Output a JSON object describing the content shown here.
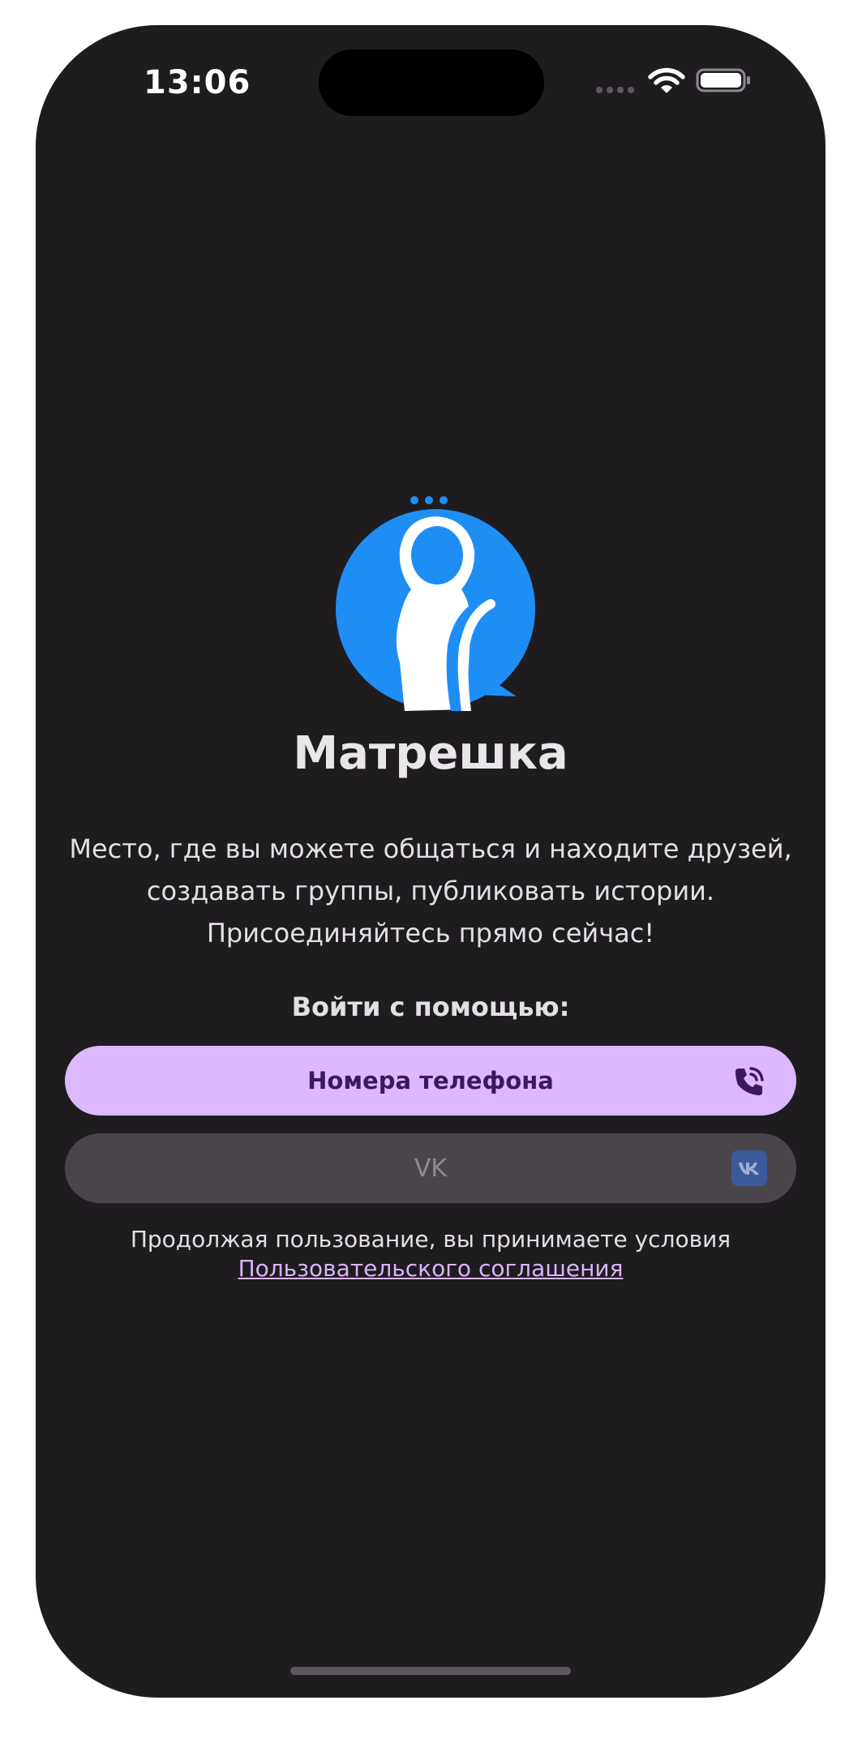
{
  "status_bar": {
    "time": "13:06"
  },
  "app": {
    "name": "Матрешка",
    "description_lines": [
      "Место, где вы можете общаться и находите друзей,",
      "создавать группы, публиковать истории.",
      "Присоединяйтесь прямо сейчас!"
    ]
  },
  "login": {
    "label": "Войти с помощью:",
    "phone_button_label": "Номера телефона",
    "vk_button_label": "VK"
  },
  "terms": {
    "text": "Продолжая пользование, вы принимаете условия",
    "link": "Пользовательского соглашения"
  },
  "colors": {
    "background": "#1f1c20",
    "logo_blue": "#1e8ef5",
    "primary_button": "#dcb8ff",
    "disabled_button": "#4a454b",
    "link": "#d8b4fe"
  },
  "icons": {
    "logo": "matryoshka-chat-logo",
    "phone_button": "phone-call-icon",
    "vk_button": "vk-icon",
    "status": [
      "cellular-signal-icon",
      "wifi-icon",
      "battery-icon"
    ]
  }
}
